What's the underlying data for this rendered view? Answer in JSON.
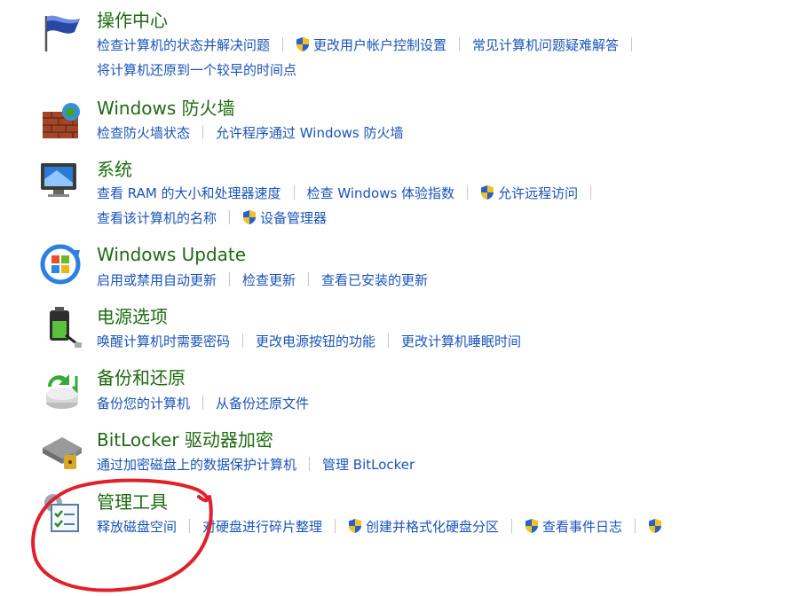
{
  "sections": [
    {
      "title": "操作中心",
      "icon": "flag-icon",
      "row1": [
        "检查计算机的状态并解决问题",
        "更改用户帐户控制设置",
        "常见计算机问题疑难解答"
      ],
      "row2": [
        "将计算机还原到一个较早的时间点"
      ]
    },
    {
      "title": "Windows 防火墙",
      "icon": "firewall-icon",
      "row1": [
        "检查防火墙状态",
        "允许程序通过 Windows 防火墙"
      ]
    },
    {
      "title": "系统",
      "icon": "system-icon",
      "row1": [
        "查看 RAM 的大小和处理器速度",
        "检查 Windows 体验指数",
        "允许远程访问"
      ],
      "row2": [
        "查看该计算机的名称",
        "设备管理器"
      ]
    },
    {
      "title": "Windows Update",
      "icon": "windows-update-icon",
      "row1": [
        "启用或禁用自动更新",
        "检查更新",
        "查看已安装的更新"
      ]
    },
    {
      "title": "电源选项",
      "icon": "battery-icon",
      "row1": [
        "唤醒计算机时需要密码",
        "更改电源按钮的功能",
        "更改计算机睡眠时间"
      ]
    },
    {
      "title": "备份和还原",
      "icon": "backup-icon",
      "row1": [
        "备份您的计算机",
        "从备份还原文件"
      ]
    },
    {
      "title": "BitLocker 驱动器加密",
      "icon": "bitlocker-icon",
      "row1": [
        "通过加密磁盘上的数据保护计算机",
        "管理 BitLocker"
      ]
    },
    {
      "title": "管理工具",
      "icon": "admin-tools-icon",
      "row1": [
        "释放磁盘空间",
        "对硬盘进行碎片整理",
        "创建并格式化硬盘分区",
        "查看事件日志"
      ]
    }
  ],
  "colors": {
    "title": "#1e6b12",
    "link": "#1a54b8",
    "separator": "#c7c7c7",
    "annotation": "#e0202a"
  }
}
